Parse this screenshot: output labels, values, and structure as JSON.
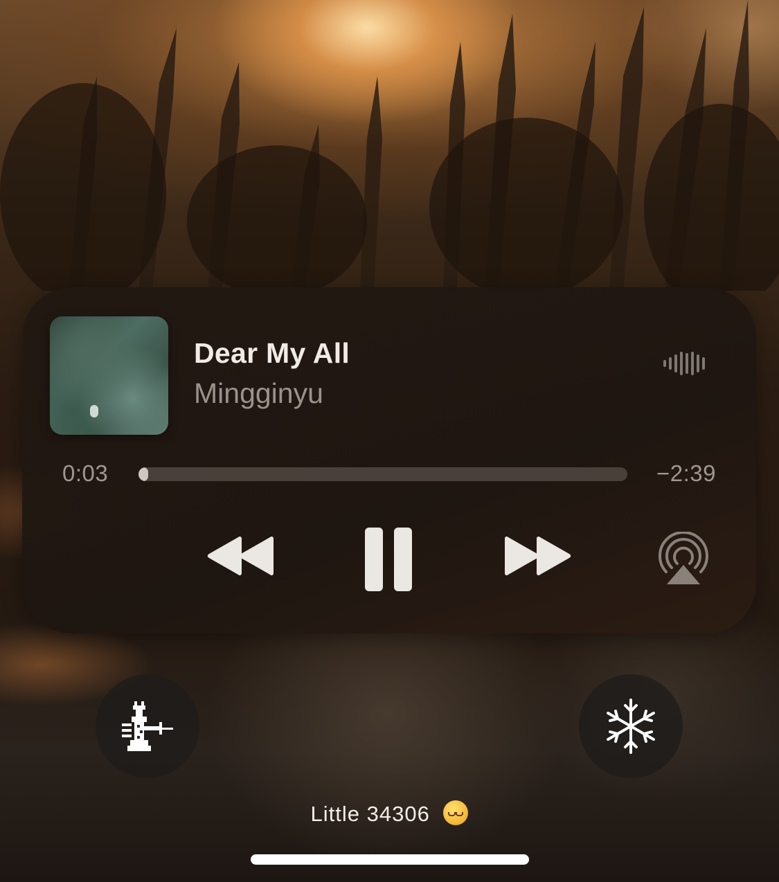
{
  "now_playing": {
    "title": "Dear My All",
    "artist": "Mingginyu",
    "elapsed": "0:03",
    "remaining": "−2:39",
    "progress_fraction": 0.02,
    "controls": {
      "rewind_icon": "rewind-icon",
      "pause_icon": "pause-icon",
      "forward_icon": "fast-forward-icon",
      "airplay_icon": "airplay-icon",
      "waveform_icon": "audio-waveform-icon"
    }
  },
  "lockscreen_buttons": {
    "left_icon": "chess-jailbreak-icon",
    "right_icon": "snowflake-icon"
  },
  "footer": {
    "text": "Little 34306",
    "emoji": "smiling-face-with-hearts-emoji"
  },
  "colors": {
    "widget_background": "#221812",
    "primary_text": "#f0ebe6",
    "secondary_text": "#9c928b",
    "progress_track": "#4a403a",
    "progress_fill": "#cfc8c2",
    "button_background": "#1e1c1b"
  }
}
